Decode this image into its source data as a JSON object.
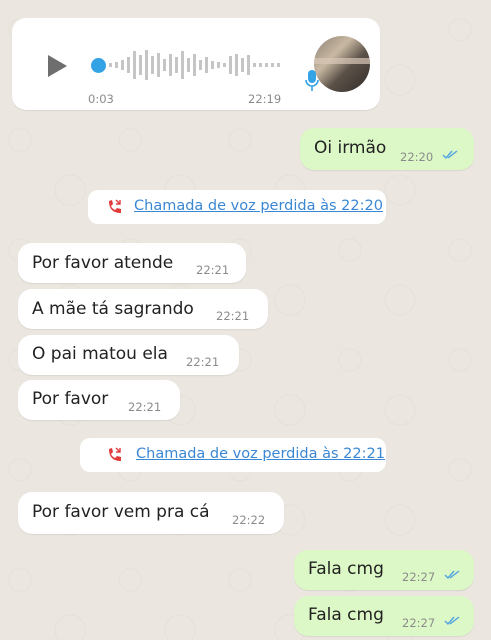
{
  "voice_note": {
    "duration": "0:03",
    "time": "22:19",
    "accent": "#34a3e6",
    "icons": {
      "play": "play-icon",
      "mic": "microphone-icon"
    }
  },
  "messages": [
    {
      "dir": "out",
      "text": "Oi irmão",
      "time": "22:20"
    },
    {
      "dir": "in",
      "text": "Por favor atende",
      "time": "22:21"
    },
    {
      "dir": "in",
      "text": "A mãe tá sagrando",
      "time": "22:21"
    },
    {
      "dir": "in",
      "text": "O pai matou ela",
      "time": "22:21"
    },
    {
      "dir": "in",
      "text": "Por favor",
      "time": "22:21"
    },
    {
      "dir": "in",
      "text": "Por favor vem pra cá",
      "time": "22:22"
    },
    {
      "dir": "out",
      "text": "Fala cmg",
      "time": "22:27"
    },
    {
      "dir": "out",
      "text": "Fala cmg",
      "time": "22:27"
    }
  ],
  "missed_calls": [
    {
      "text": "Chamada de voz perdida às 22:20"
    },
    {
      "text": "Chamada de voz perdida às 22:21"
    }
  ],
  "colors": {
    "background": "#ebe7e0",
    "incoming": "#ffffff",
    "outgoing": "#dcf8c6",
    "link": "#3a87d4",
    "missed_call_icon": "#e23b3b",
    "read_ticks": "#4fa3e0"
  }
}
